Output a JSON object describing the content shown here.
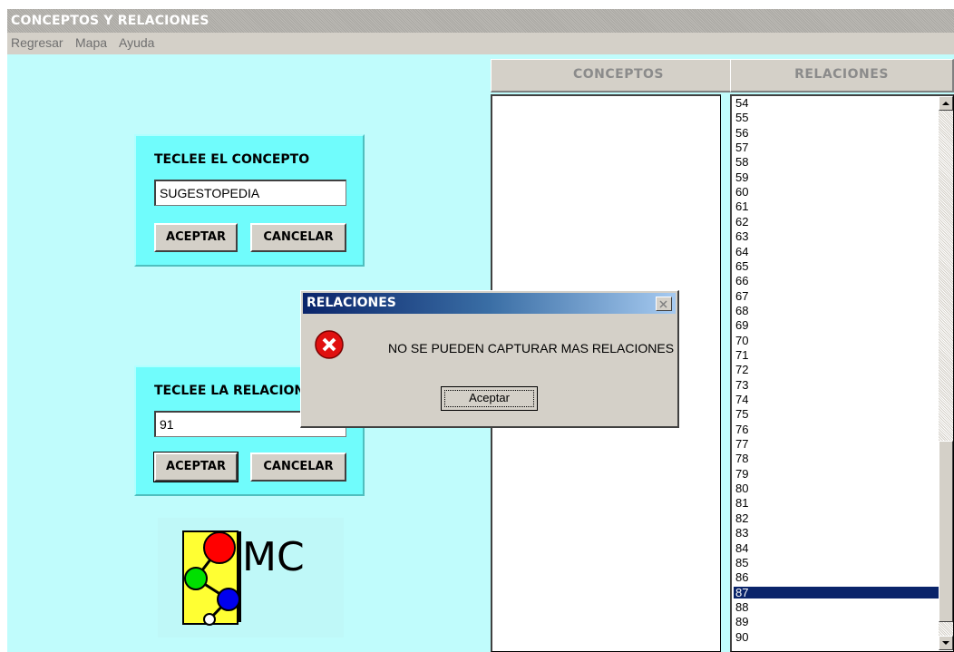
{
  "window": {
    "title": "CONCEPTOS Y RELACIONES"
  },
  "menu": [
    "Regresar",
    "Mapa",
    "Ayuda"
  ],
  "headers": {
    "conceptos": "CONCEPTOS",
    "relaciones": "RELACIONES"
  },
  "concept_panel": {
    "title": "TECLEE EL CONCEPTO",
    "value": "SUGESTOPEDIA",
    "accept": "ACEPTAR",
    "cancel": "CANCELAR"
  },
  "relation_panel": {
    "title": "TECLEE LA RELACION",
    "value": "91",
    "accept": "ACEPTAR",
    "cancel": "CANCELAR"
  },
  "relations": [
    "54",
    "55",
    "56",
    "57",
    "58",
    "59",
    "60",
    "61",
    "62",
    "63",
    "64",
    "65",
    "66",
    "67",
    "68",
    "69",
    "70",
    "71",
    "72",
    "73",
    "74",
    "75",
    "76",
    "77",
    "78",
    "79",
    "80",
    "81",
    "82",
    "83",
    "84",
    "85",
    "86",
    "87",
    "88",
    "89",
    "90"
  ],
  "selected_relation": "87",
  "logo": {
    "text": "MC",
    "icon": "concept-map-logo"
  },
  "dialog": {
    "title": "RELACIONES",
    "message": "NO SE PUEDEN CAPTURAR MAS RELACIONES",
    "ok": "Aceptar",
    "icon": "error-icon"
  },
  "colors": {
    "client_bg": "#c0fcfc",
    "panel_bg": "#70fcfc",
    "selection": "#0a246a"
  }
}
